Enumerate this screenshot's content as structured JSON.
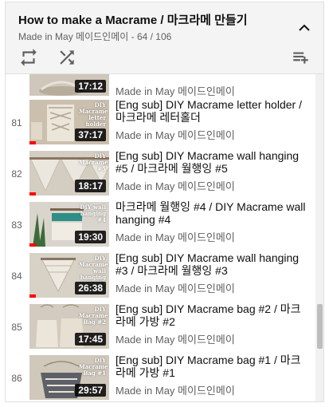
{
  "playlist": {
    "title": "How to make a Macrame / 마크라메 만들기",
    "channel": "Made in May 메이드인메이",
    "position": "64 / 106",
    "separator": " - "
  },
  "controls": {
    "loop_icon": "loop-icon",
    "shuffle_icon": "shuffle-icon",
    "save_icon": "playlist-add-icon",
    "collapse_icon": "chevron-up-icon"
  },
  "items": [
    {
      "index": "",
      "title": "",
      "channel": "Made in May 메이드인메이",
      "duration": "17:12",
      "tag": "",
      "progress": 0.0
    },
    {
      "index": "81",
      "title": "[Eng sub] DIY Macrame letter holder / 마크라메 레터홀더",
      "channel": "Made in May 메이드인메이",
      "duration": "37:17",
      "tag": "DIY Macrame letter holder",
      "progress": 0.08
    },
    {
      "index": "82",
      "title": "[Eng sub] DIY Macrame wall hanging #5 / 마크라메 월행잉 #5",
      "channel": "Made in May 메이드인메이",
      "duration": "18:17",
      "tag": "DIY Macrame #5",
      "progress": 0.08
    },
    {
      "index": "83",
      "title": "마크라메 월행잉 #4 / DIY Macrame wall hanging #4",
      "channel": "Made in May 메이드인메이",
      "duration": "19:30",
      "tag": "DIY wall hanging #4",
      "progress": 0.08
    },
    {
      "index": "84",
      "title": "[Eng sub] DIY Macrame wall hanging #3 / 마크라메 월행잉 #3",
      "channel": "Made in May 메이드인메이",
      "duration": "26:38",
      "tag": "DIY Macrame wall hanging #3",
      "progress": 0.08
    },
    {
      "index": "85",
      "title": "[Eng sub] DIY Macrame bag #2 / 마크라메 가방 #2",
      "channel": "Made in May 메이드인메이",
      "duration": "17:45",
      "tag": "DIY Macrame Bag #2",
      "progress": 0.0
    },
    {
      "index": "86",
      "title": "[Eng sub] DIY Macrame bag #1 / 마크라메 가방 #1",
      "channel": "Made in May 메이드인메이",
      "duration": "29:57",
      "tag": "DIY Macrame Bag #1",
      "progress": 0.0
    }
  ],
  "colors": {
    "accent": "#ff0000",
    "header_bg": "#f4f4f4",
    "secondary_text": "#606060"
  }
}
